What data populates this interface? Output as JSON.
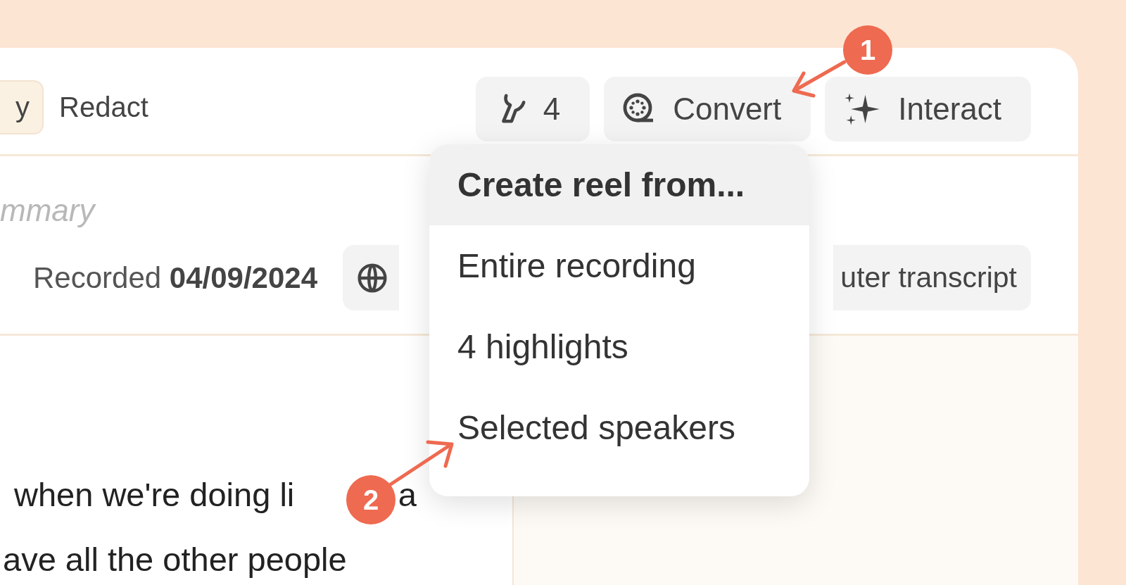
{
  "toolbar": {
    "tabs": [
      {
        "label": "y",
        "selected": true
      },
      {
        "label": "Redact",
        "selected": false
      }
    ],
    "buttons": [
      {
        "kind": "highlights",
        "label": "4"
      },
      {
        "kind": "convert",
        "label": "Convert"
      },
      {
        "kind": "interact",
        "label": "Interact"
      }
    ]
  },
  "title_field": {
    "placeholder": "mmary"
  },
  "recorded": "Recorded **04/09/2024**",
  "transcript_button": {
    "label": "uter transcript"
  },
  "transcript_lines": [
    {
      "segments": [
        "when we're doing li",
        "a"
      ]
    },
    {
      "segments": [
        "ave all the other people"
      ]
    }
  ],
  "dropdown": {
    "header": "Create reel from...",
    "items": [
      "Entire recording",
      "4 highlights",
      "Selected speakers"
    ]
  },
  "annotations": [
    {
      "label": "1"
    },
    {
      "label": "2"
    }
  ]
}
